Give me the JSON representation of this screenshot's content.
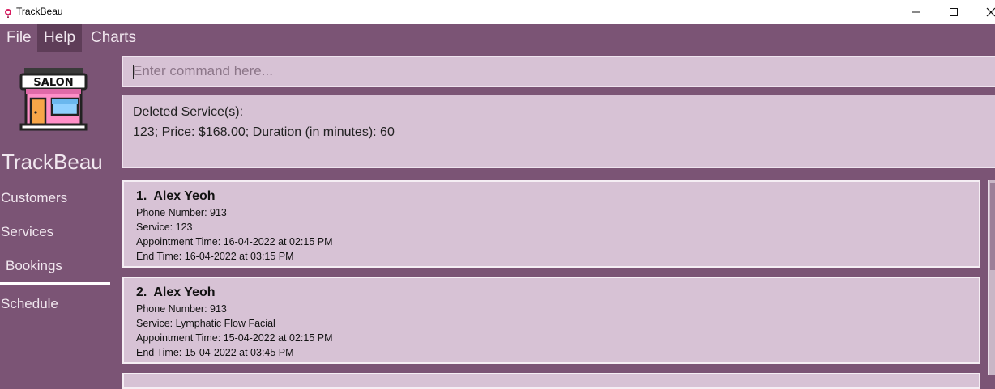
{
  "window": {
    "title": "TrackBeau",
    "minimize_glyph": "—",
    "maximize_glyph": "☐",
    "close_glyph": "✕",
    "icon": "app-flower-icon"
  },
  "menu": {
    "items": [
      {
        "label": "File"
      },
      {
        "label": "Help"
      },
      {
        "label": "Charts"
      }
    ]
  },
  "sidebar": {
    "logo_text": "SALON",
    "brand": "TrackBeau",
    "items": [
      {
        "label": "Customers"
      },
      {
        "label": "Services"
      },
      {
        "label": "Bookings"
      },
      {
        "label": "Schedule"
      }
    ],
    "active": "Bookings"
  },
  "command": {
    "placeholder": "Enter command here...",
    "value": ""
  },
  "result": {
    "line1": "Deleted Service(s):",
    "line2": "123; Price: $168.00; Duration (in minutes): 60"
  },
  "bookings": [
    {
      "index": "1.",
      "name": "Alex Yeoh",
      "phone": "Phone Number: 913",
      "service": "Service: 123",
      "appointment": "Appointment Time: 16-04-2022 at 02:15 PM",
      "end": "End Time: 16-04-2022 at 03:15 PM"
    },
    {
      "index": "2.",
      "name": "Alex Yeoh",
      "phone": "Phone Number: 913",
      "service": "Service: Lymphatic Flow Facial",
      "appointment": "Appointment Time: 15-04-2022 at 02:15 PM",
      "end": "End Time: 15-04-2022 at 03:45 PM"
    }
  ],
  "colors": {
    "background": "#7b5475",
    "panel": "#d7c2d5",
    "menu_active": "#5e3d58"
  }
}
